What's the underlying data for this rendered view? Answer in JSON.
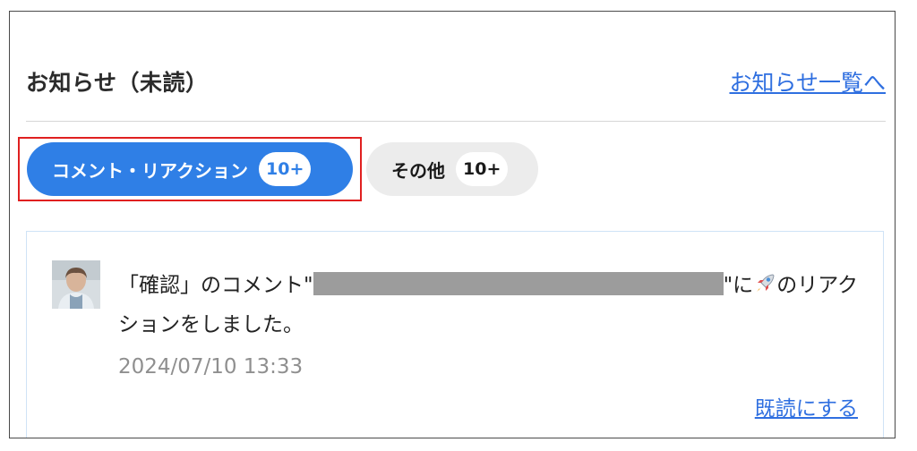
{
  "header": {
    "title": "お知らせ（未読）",
    "list_link": "お知らせ一覧へ"
  },
  "tabs": [
    {
      "label": "コメント・リアクション",
      "badge": "10+",
      "active": true
    },
    {
      "label": "その他",
      "badge": "10+",
      "active": false
    }
  ],
  "notification": {
    "text_before": "「確認」のコメント\"",
    "text_after_redacted": "\"に",
    "reaction_icon": "rocket-emoji",
    "text_after_icon": "のリアクションをしました。",
    "timestamp": "2024/07/10 13:33",
    "mark_read_label": "既読にする"
  },
  "colors": {
    "accent": "#2f7fe6",
    "link": "#2f6fe0",
    "highlight_border": "#e02020",
    "inactive_tab_bg": "#ececec"
  }
}
